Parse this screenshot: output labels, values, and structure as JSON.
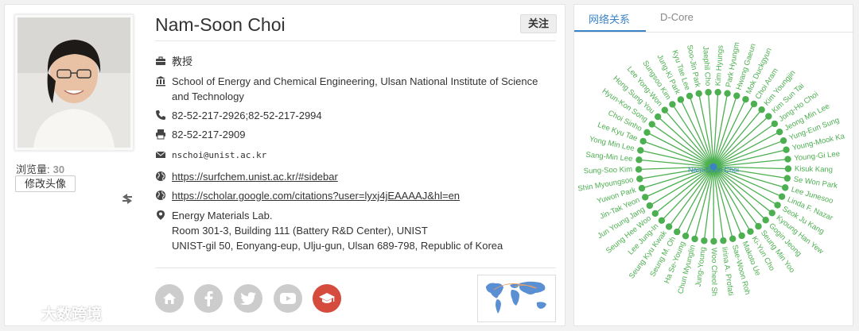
{
  "profile": {
    "name": "Nam-Soon Choi",
    "follow_label": "关注",
    "views_label": "浏览量:",
    "views_count": "30",
    "edit_avatar_label": "修改头像",
    "title": "教授",
    "affiliation": "School of Energy and Chemical Engineering, Ulsan National Institute of Science and Technology",
    "phone": "82-52-217-2926;82-52-217-2994",
    "fax": "82-52-217-2909",
    "email": "nschoi@unist.ac.kr",
    "homepage": "https://surfchem.unist.ac.kr/#sidebar",
    "scholar": "https://scholar.google.com/citations?user=lyxj4jEAAAAJ&hl=en",
    "address_line1": "Energy Materials Lab.",
    "address_line2": "Room 301-3, Building 111 (Battery R&D Center), UNIST",
    "address_line3": "UNIST-gil 50, Eonyang-eup, Ulju-gun, Ulsan 689-798, Republic of Korea"
  },
  "social_icons": [
    "home-icon",
    "facebook-icon",
    "twitter-icon",
    "youtube-icon",
    "scholar-icon"
  ],
  "watermark": "大数跨境",
  "network": {
    "tabs": [
      "网络关系",
      "D-Core"
    ],
    "active_tab": "网络关系",
    "center": "Nam-Soon Choi",
    "nodes": [
      "Kim Hyungs",
      "Park Hyungm",
      "Hwang Gaeun",
      "Mok Duckgyun",
      "Choi Aram",
      "Kim Youngjin",
      "Kim Sun Tai",
      "Jong-Ho Choi",
      "Jeong Min Lee",
      "Yung-Eun Sung",
      "Young-Mook Ka",
      "Young-Gi Lee",
      "Kisuk Kang",
      "Se Won Park",
      "Lee Junesoo",
      "Linda F. Nazar",
      "Seok Ju Kang",
      "Kyoung Han Yew",
      "Gogin Jeong",
      "Seung Min Yoo",
      "Ki-Yun Cho",
      "Makoto Ue",
      "Sae-Woon Roh",
      "Iirina A. Profati",
      "Woo Cheol Sh",
      "Jung-Young",
      "Chun Myunglin",
      "Ha Se-Young",
      "Seung M. Oh",
      "Seung Kyu Kwak",
      "Lee Jung-In",
      "Seung Hee Woo",
      "Jun Young Jang",
      "Jin-Tak Yeon",
      "Yuwon Park",
      "Shin Myoungsoo",
      "Sung-Soo Kim",
      "Sang-Min Lee",
      "Yong Min Lee",
      "Lee Kyu Tae",
      "Choi Sinho",
      "Hyun-Kon Song",
      "Hong Sung You",
      "Lee Yong-Won",
      "Sungsoo Kim",
      "Jung-Ki Park",
      "Kyu Tae Lee",
      "Soo-Jin Park",
      "Jaephil Cho"
    ],
    "node_color": "#4caf50",
    "center_color": "#3b83c6"
  }
}
